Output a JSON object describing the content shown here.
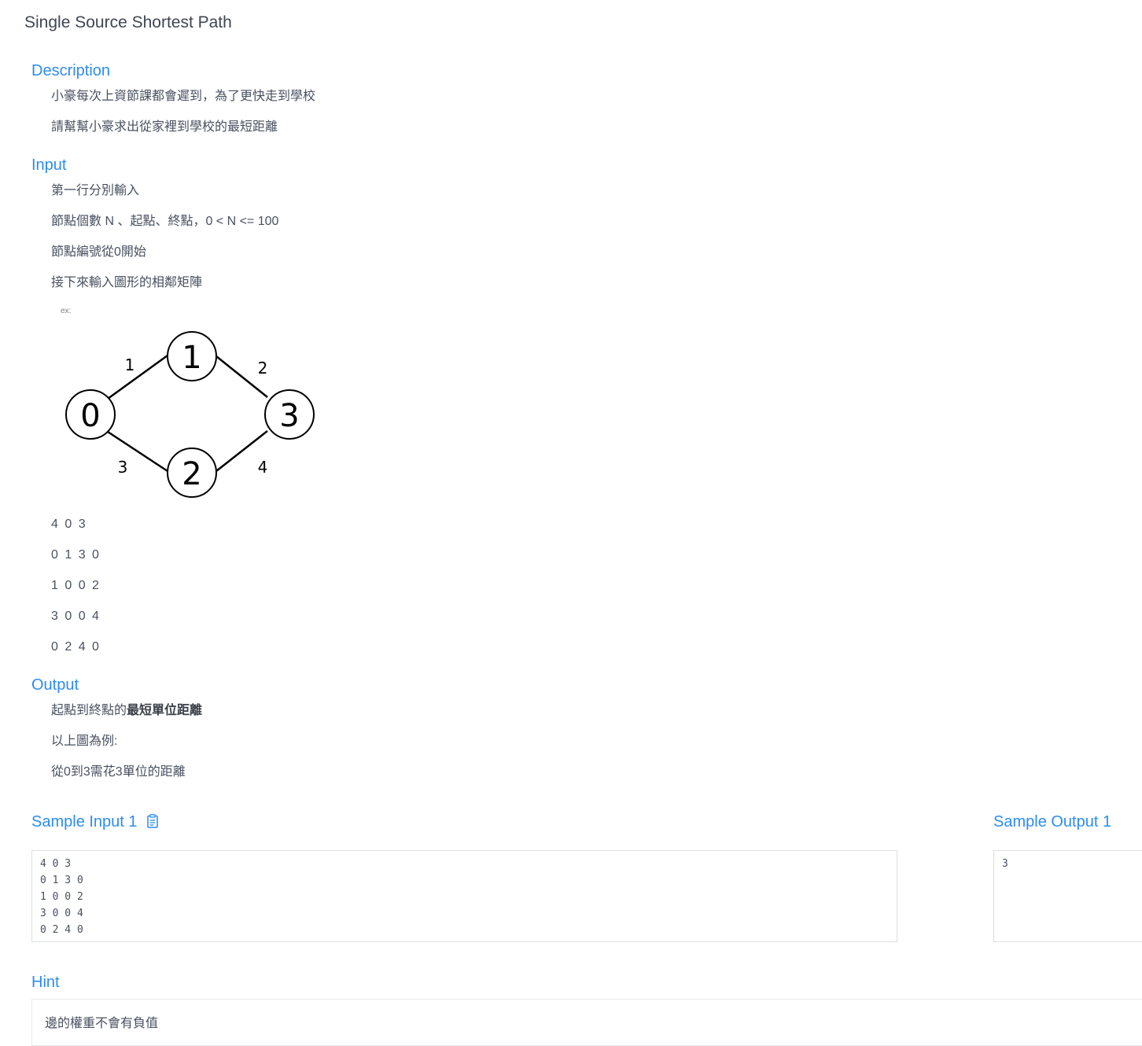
{
  "page_title": "Single Source Shortest Path",
  "description": {
    "title": "Description",
    "paragraphs": [
      "小豪每次上資節課都會遲到，為了更快走到學校",
      "請幫幫小豪求出從家裡到學校的最短距離"
    ]
  },
  "input": {
    "title": "Input",
    "paragraphs": [
      "第一行分別輸入",
      "節點個數 N 、起點、終點，0 < N <= 100",
      "節點編號從0開始",
      "接下來輸入圖形的相鄰矩陣"
    ],
    "example_label": "ex:",
    "graph": {
      "nodes": [
        "0",
        "1",
        "2",
        "3"
      ],
      "edge_weights": [
        "1",
        "2",
        "3",
        "4"
      ]
    },
    "matrix_lines": [
      "4 0 3",
      "0 1 3 0",
      "1 0 0 2",
      "3 0 0 4",
      "0 2 4 0"
    ]
  },
  "output": {
    "title": "Output",
    "line1_prefix": "起點到終點的",
    "line1_bold": "最短單位距離",
    "paragraphs": [
      "以上圖為例:",
      "從0到3需花3單位的距離"
    ]
  },
  "sample_input": {
    "title": "Sample Input 1",
    "content": "4 0 3\n0 1 3 0\n1 0 0 2\n3 0 0 4\n0 2 4 0"
  },
  "sample_output": {
    "title": "Sample Output 1",
    "content": "3"
  },
  "hint": {
    "title": "Hint",
    "text": "邊的權重不會有負值"
  },
  "colors": {
    "accent": "#2d8cf0",
    "text": "#495060",
    "border": "#dddee1"
  }
}
